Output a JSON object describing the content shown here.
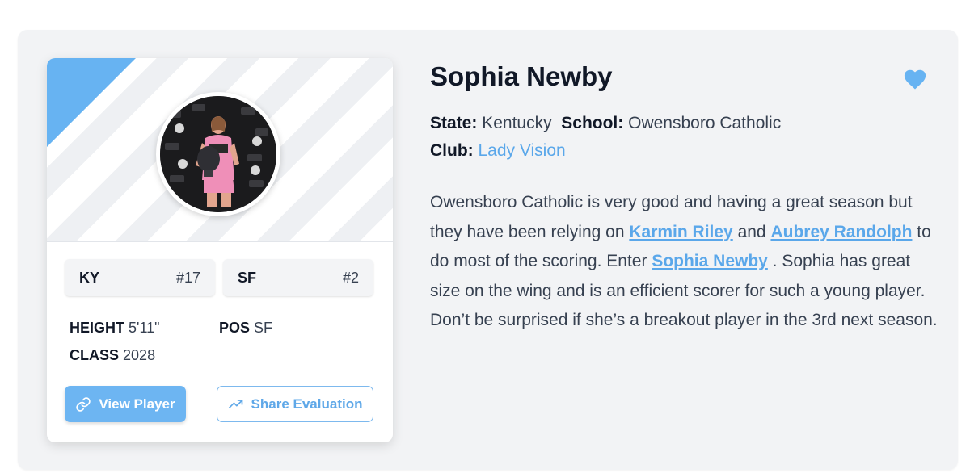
{
  "player": {
    "name": "Sophia Newby",
    "state_label": "State:",
    "state": "Kentucky",
    "school_label": "School:",
    "school": "Owensboro Catholic",
    "club_label": "Club:",
    "club": "Lady Vision"
  },
  "card": {
    "tags": [
      {
        "key": "KY",
        "value": "#17"
      },
      {
        "key": "SF",
        "value": "#2"
      }
    ],
    "height_label": "HEIGHT",
    "height": "5'11\"",
    "pos_label": "POS",
    "pos": "SF",
    "class_label": "CLASS",
    "class": "2028",
    "view_button": "View Player",
    "share_button": "Share Evaluation"
  },
  "description": {
    "p1": "Owensboro Catholic is very good and having a great season but they have been relying on ",
    "link1": "Karmin Riley",
    "p2": " and ",
    "link2": "Aubrey Randolph",
    "p3": " to do most of the scoring. Enter ",
    "link3": "Sophia Newby",
    "p4": " . Sophia has great size on the wing and is an efficient scorer for such a young player. Don’t be surprised if she’s a breakout player in the 3rd next season."
  },
  "icons": {
    "favorite": "heart-icon",
    "view": "link-icon",
    "share": "trending-up-icon"
  },
  "colors": {
    "accent": "#67b3f2",
    "link": "#5aa7ea",
    "background": "#f2f3f5"
  }
}
